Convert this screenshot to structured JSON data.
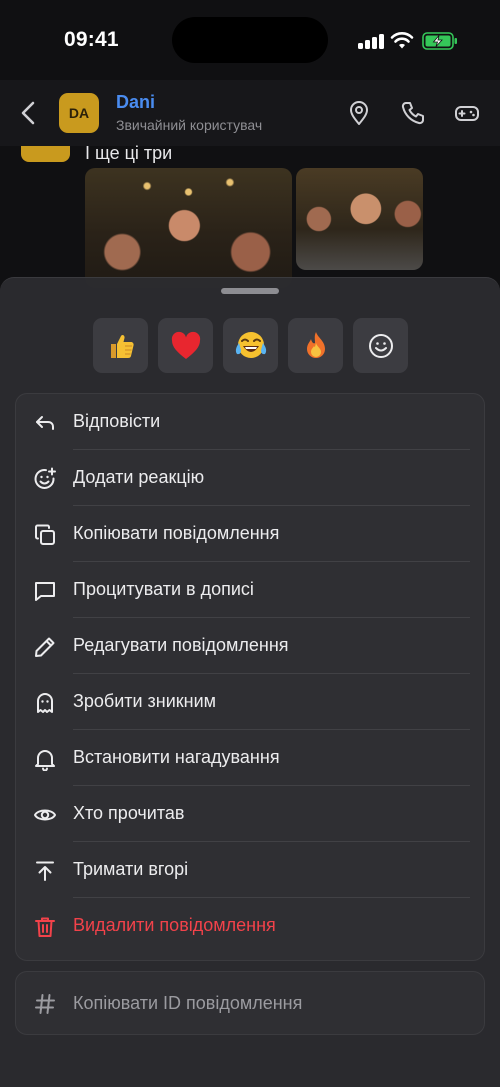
{
  "status_bar": {
    "time": "09:41"
  },
  "chat_header": {
    "avatar_initials": "DA",
    "name": "Dani",
    "subtitle": "Звичайний користувач",
    "icons": [
      "back-icon",
      "location-pin-icon",
      "phone-icon",
      "gamepad-icon"
    ]
  },
  "message": {
    "text": "І ще ці три"
  },
  "reactions": [
    {
      "name": "thumbs-up",
      "glyph": "👍"
    },
    {
      "name": "heart",
      "glyph": "❤️"
    },
    {
      "name": "tears-of-joy",
      "glyph": "😂"
    },
    {
      "name": "fire",
      "glyph": "🔥"
    },
    {
      "name": "more-emoji",
      "glyph": "☺"
    }
  ],
  "menu": {
    "items": [
      {
        "label": "Відповісти",
        "icon": "reply-icon"
      },
      {
        "label": "Додати реакцію",
        "icon": "add-reaction-icon"
      },
      {
        "label": "Копіювати повідомлення",
        "icon": "copy-icon"
      },
      {
        "label": "Процитувати в дописі",
        "icon": "quote-icon"
      },
      {
        "label": "Редагувати повідомлення",
        "icon": "pencil-icon"
      },
      {
        "label": "Зробити зникним",
        "icon": "ghost-icon"
      },
      {
        "label": "Встановити нагадування",
        "icon": "bell-icon"
      },
      {
        "label": "Хто прочитав",
        "icon": "eye-icon"
      },
      {
        "label": "Тримати вгорі",
        "icon": "pin-top-icon"
      },
      {
        "label": "Видалити повідомлення",
        "icon": "trash-icon",
        "danger": true
      }
    ],
    "copy_id_label": "Копіювати ID повідомлення"
  },
  "colors": {
    "accent_blue": "#4a8cf0",
    "danger_red": "#f2424a",
    "avatar_gold": "#c99a1e"
  }
}
